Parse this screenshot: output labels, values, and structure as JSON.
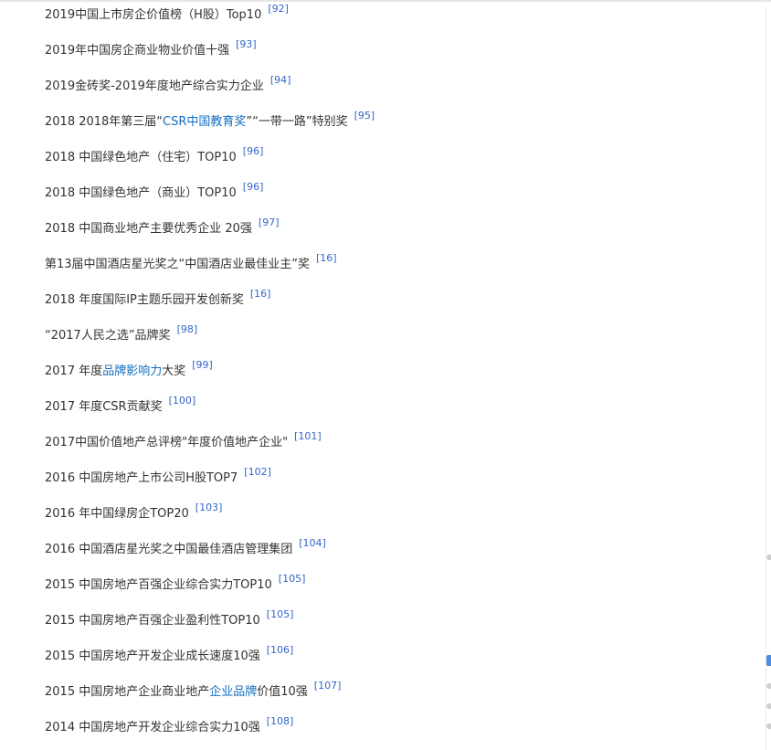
{
  "awards": [
    {
      "parts": [
        "2019中国上市房企价值榜（H股）Top10"
      ],
      "ref": "[92]"
    },
    {
      "parts": [
        "2019年中国房企商业物业价值十强"
      ],
      "ref": "[93]"
    },
    {
      "parts": [
        "2019金砖奖-2019年度地产综合实力企业"
      ],
      "ref": "[94]"
    },
    {
      "parts": [
        "2018 2018年第三届“",
        "CSR中国教育奖",
        "”“一带一路”特别奖"
      ],
      "ref": "[95]"
    },
    {
      "parts": [
        "2018 中国绿色地产（住宅）TOP10"
      ],
      "ref": "[96]"
    },
    {
      "parts": [
        "2018 中国绿色地产（商业）TOP10"
      ],
      "ref": "[96]"
    },
    {
      "parts": [
        "2018 中国商业地产主要优秀企业 20强"
      ],
      "ref": "[97]"
    },
    {
      "parts": [
        "第13届中国酒店星光奖之“中国酒店业最佳业主”奖"
      ],
      "ref": "[16]"
    },
    {
      "parts": [
        "2018 年度国际IP主题乐园开发创新奖"
      ],
      "ref": "[16]"
    },
    {
      "parts": [
        "“2017人民之选”品牌奖"
      ],
      "ref": "[98]"
    },
    {
      "parts": [
        "2017 年度",
        "品牌影响力",
        "大奖"
      ],
      "ref": "[99]"
    },
    {
      "parts": [
        "2017 年度CSR贡献奖"
      ],
      "ref": "[100]"
    },
    {
      "parts": [
        "2017中国价值地产总评榜\"年度价值地产企业\""
      ],
      "ref": "[101]"
    },
    {
      "parts": [
        "2016 中国房地产上市公司H股TOP7"
      ],
      "ref": "[102]"
    },
    {
      "parts": [
        "2016 年中国绿房企TOP20"
      ],
      "ref": "[103]"
    },
    {
      "parts": [
        "2016 中国酒店星光奖之中国最佳酒店管理集团"
      ],
      "ref": "[104]"
    },
    {
      "parts": [
        "2015 中国房地产百强企业综合实力TOP10"
      ],
      "ref": "[105]"
    },
    {
      "parts": [
        "2015 中国房地产百强企业盈利性TOP10"
      ],
      "ref": "[105]"
    },
    {
      "parts": [
        "2015 中国房地产开发企业成长速度10强"
      ],
      "ref": "[106]"
    },
    {
      "parts": [
        "2015 中国房地产企业商业地产",
        "企业品牌",
        "价值10强"
      ],
      "ref": "[107]"
    },
    {
      "parts": [
        "2014 中国房地产开发企业综合实力10强"
      ],
      "ref": "[108]"
    }
  ],
  "colors": {
    "text": "#333333",
    "link": "#136ec2",
    "reference": "#3366cc",
    "scroll_indicator": "#4d8ee0"
  }
}
